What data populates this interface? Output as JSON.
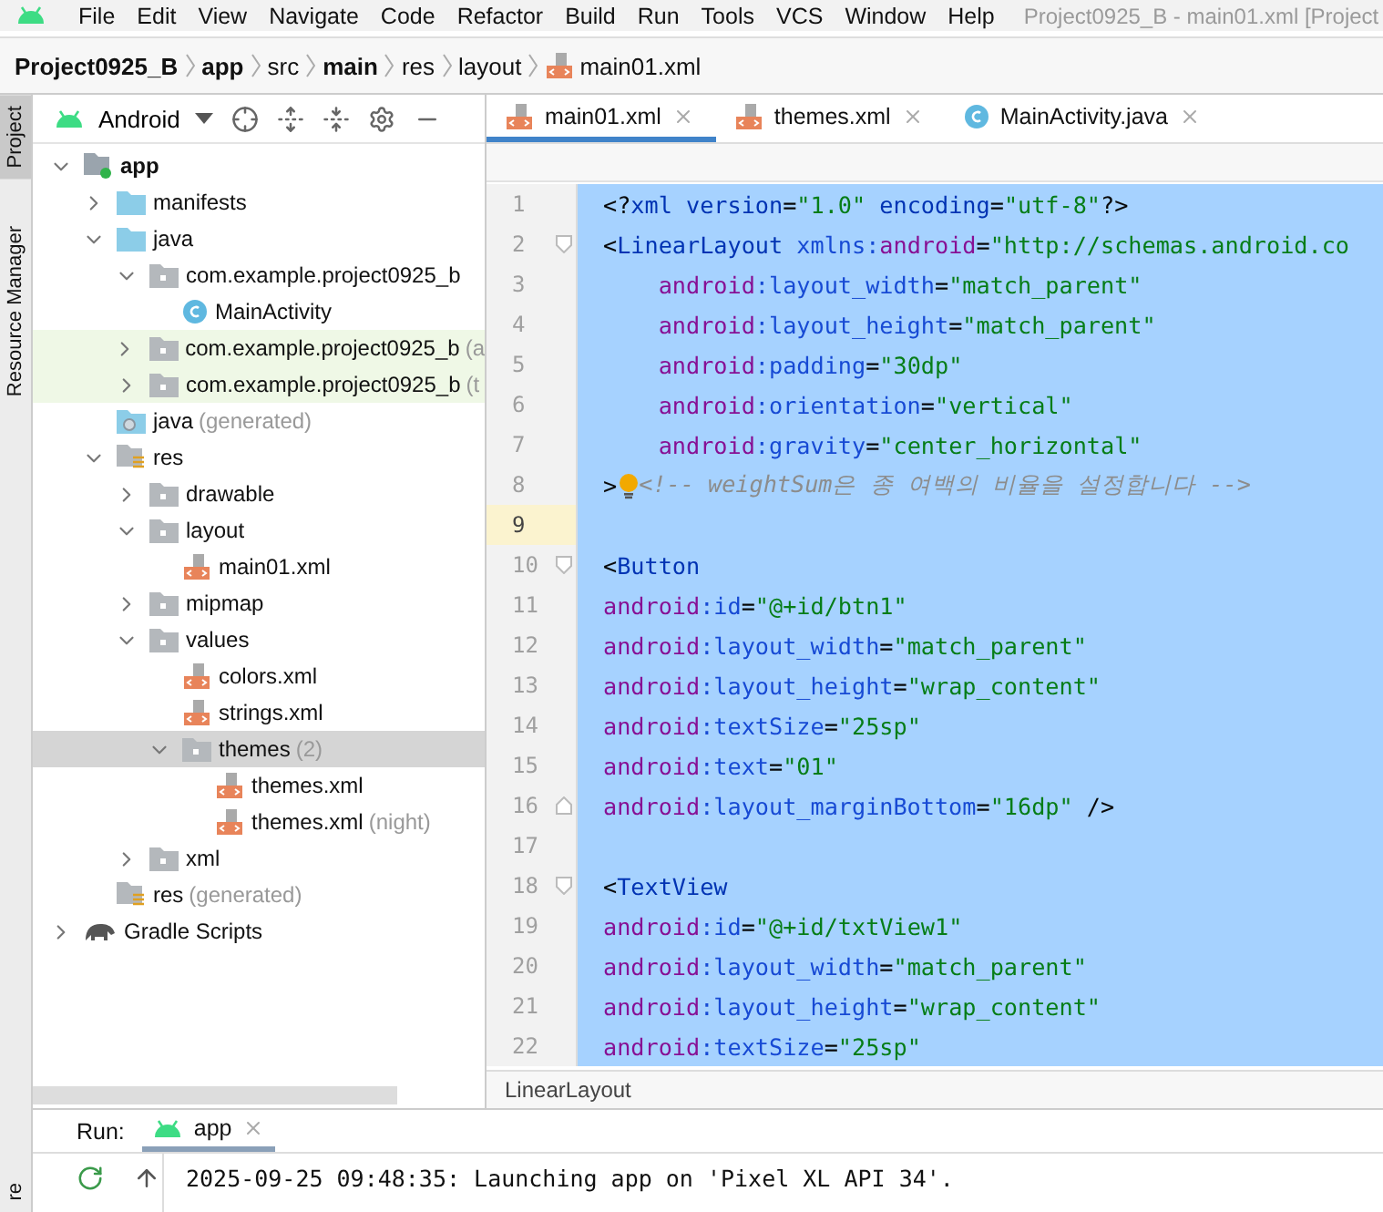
{
  "menu_bar": {
    "items": [
      "File",
      "Edit",
      "View",
      "Navigate",
      "Code",
      "Refactor",
      "Build",
      "Run",
      "Tools",
      "VCS",
      "Window",
      "Help"
    ],
    "title": "Project0925_B - main01.xml [Project"
  },
  "breadcrumb": [
    {
      "label": "Project0925_B",
      "bold": true,
      "kind": "text"
    },
    {
      "label": "app",
      "bold": true,
      "kind": "text"
    },
    {
      "label": "src",
      "bold": false,
      "kind": "text"
    },
    {
      "label": "main",
      "bold": true,
      "kind": "text"
    },
    {
      "label": "res",
      "bold": false,
      "kind": "text"
    },
    {
      "label": "layout",
      "bold": false,
      "kind": "text"
    },
    {
      "label": "main01.xml",
      "bold": false,
      "kind": "xml"
    }
  ],
  "side_strip": {
    "top": [
      "Project",
      "Resource Manager"
    ],
    "bottom": "re"
  },
  "project_panel": {
    "view": "Android",
    "tree": [
      {
        "label": "app",
        "kind": "module",
        "expanded": true,
        "selected": false,
        "highlight": false,
        "children": [
          {
            "label": "manifests",
            "kind": "bluefolder",
            "expanded": false,
            "selected": false,
            "highlight": false
          },
          {
            "label": "java",
            "kind": "bluefolder",
            "expanded": true,
            "selected": false,
            "highlight": false,
            "children": [
              {
                "label": "com.example.project0925_b",
                "kind": "package",
                "expanded": true,
                "selected": false,
                "highlight": false,
                "children": [
                  {
                    "label": "MainActivity",
                    "kind": "class",
                    "selected": false,
                    "highlight": false
                  }
                ]
              },
              {
                "label": "com.example.project0925_b",
                "hint": "(a",
                "kind": "package",
                "expanded": false,
                "selected": false,
                "highlight": true
              },
              {
                "label": "com.example.project0925_b",
                "hint": "(t",
                "kind": "package",
                "expanded": false,
                "selected": false,
                "highlight": true
              }
            ]
          },
          {
            "label": "java",
            "hint": "(generated)",
            "kind": "generated",
            "selected": false,
            "highlight": false
          },
          {
            "label": "res",
            "kind": "res",
            "expanded": true,
            "selected": false,
            "highlight": false,
            "children": [
              {
                "label": "drawable",
                "kind": "package",
                "expanded": false,
                "selected": false,
                "highlight": false
              },
              {
                "label": "layout",
                "kind": "package",
                "expanded": true,
                "selected": false,
                "highlight": false,
                "children": [
                  {
                    "label": "main01.xml",
                    "kind": "xml",
                    "selected": false,
                    "highlight": false
                  }
                ]
              },
              {
                "label": "mipmap",
                "kind": "package",
                "expanded": false,
                "selected": false,
                "highlight": false
              },
              {
                "label": "values",
                "kind": "package",
                "expanded": true,
                "selected": false,
                "highlight": false,
                "children": [
                  {
                    "label": "colors.xml",
                    "kind": "xml",
                    "selected": false,
                    "highlight": false
                  },
                  {
                    "label": "strings.xml",
                    "kind": "xml",
                    "selected": false,
                    "highlight": false
                  },
                  {
                    "label": "themes",
                    "hint": "(2)",
                    "kind": "package",
                    "expanded": true,
                    "selected": true,
                    "highlight": false,
                    "children": [
                      {
                        "label": "themes.xml",
                        "kind": "xml",
                        "selected": false,
                        "highlight": false
                      },
                      {
                        "label": "themes.xml",
                        "hint": "(night)",
                        "kind": "xml",
                        "selected": false,
                        "highlight": false
                      }
                    ]
                  }
                ]
              },
              {
                "label": "xml",
                "kind": "package",
                "expanded": false,
                "selected": false,
                "highlight": false
              }
            ]
          },
          {
            "label": "res",
            "hint": "(generated)",
            "kind": "res",
            "selected": false,
            "highlight": false
          }
        ]
      },
      {
        "label": "Gradle Scripts",
        "kind": "gradle",
        "expanded": false,
        "selected": false,
        "highlight": false
      }
    ]
  },
  "editor_tabs": [
    {
      "label": "main01.xml",
      "kind": "xml",
      "selected": true
    },
    {
      "label": "themes.xml",
      "kind": "xml",
      "selected": false
    },
    {
      "label": "MainActivity.java",
      "kind": "class",
      "selected": false
    }
  ],
  "code_lines": [
    {
      "number": "1",
      "selected": true,
      "current": false,
      "tokens": [
        {
          "kind": "punct",
          "text": "<?"
        },
        {
          "kind": "tag",
          "text": "xml version"
        },
        {
          "kind": "punct",
          "text": "="
        },
        {
          "kind": "value",
          "text": "\"1.0\""
        },
        {
          "kind": "tag",
          "text": " encoding"
        },
        {
          "kind": "punct",
          "text": "="
        },
        {
          "kind": "value",
          "text": "\"utf-8\""
        },
        {
          "kind": "punct",
          "text": "?>"
        }
      ]
    },
    {
      "number": "2",
      "selected": true,
      "current": false,
      "fold_start": true,
      "tokens": [
        {
          "kind": "punct",
          "text": "<"
        },
        {
          "kind": "tag",
          "text": "LinearLayout "
        },
        {
          "kind": "attr",
          "text": "xmlns:"
        },
        {
          "kind": "ns",
          "text": "android"
        },
        {
          "kind": "punct",
          "text": "="
        },
        {
          "kind": "value",
          "text": "\"http://schemas.android.co"
        }
      ]
    },
    {
      "number": "3",
      "selected": true,
      "current": false,
      "tokens": [
        {
          "kind": "ns",
          "text": "    android"
        },
        {
          "kind": "attr",
          "text": ":layout_width"
        },
        {
          "kind": "punct",
          "text": "="
        },
        {
          "kind": "value",
          "text": "\"match_parent\""
        }
      ]
    },
    {
      "number": "4",
      "selected": true,
      "current": false,
      "tokens": [
        {
          "kind": "ns",
          "text": "    android"
        },
        {
          "kind": "attr",
          "text": ":layout_height"
        },
        {
          "kind": "punct",
          "text": "="
        },
        {
          "kind": "value",
          "text": "\"match_parent\""
        }
      ]
    },
    {
      "number": "5",
      "selected": true,
      "current": false,
      "tokens": [
        {
          "kind": "ns",
          "text": "    android"
        },
        {
          "kind": "attr",
          "text": ":padding"
        },
        {
          "kind": "punct",
          "text": "="
        },
        {
          "kind": "value",
          "text": "\"30dp\""
        }
      ]
    },
    {
      "number": "6",
      "selected": true,
      "current": false,
      "tokens": [
        {
          "kind": "ns",
          "text": "    android"
        },
        {
          "kind": "attr",
          "text": ":orientation"
        },
        {
          "kind": "punct",
          "text": "="
        },
        {
          "kind": "value",
          "text": "\"vertical\""
        }
      ]
    },
    {
      "number": "7",
      "selected": true,
      "current": false,
      "tokens": [
        {
          "kind": "ns",
          "text": "    android"
        },
        {
          "kind": "attr",
          "text": ":gravity"
        },
        {
          "kind": "punct",
          "text": "="
        },
        {
          "kind": "value",
          "text": "\"center_horizontal\""
        }
      ]
    },
    {
      "number": "8",
      "selected": true,
      "current": false,
      "tokens": [
        {
          "kind": "punct",
          "text": ">"
        },
        {
          "kind": "bulb"
        },
        {
          "kind": "comment",
          "text": "<!-- weightSum은 종 여백의 비율을 설정합니다 -->"
        }
      ]
    },
    {
      "number": "9",
      "selected": true,
      "current": true
    },
    {
      "number": "10",
      "selected": true,
      "current": false,
      "fold_start": true,
      "tokens": [
        {
          "kind": "punct",
          "text": "<"
        },
        {
          "kind": "tag",
          "text": "Button"
        }
      ]
    },
    {
      "number": "11",
      "selected": true,
      "current": false,
      "tokens": [
        {
          "kind": "ns",
          "text": "android"
        },
        {
          "kind": "attr",
          "text": ":id"
        },
        {
          "kind": "punct",
          "text": "="
        },
        {
          "kind": "value",
          "text": "\"@+id/btn1\""
        }
      ]
    },
    {
      "number": "12",
      "selected": true,
      "current": false,
      "tokens": [
        {
          "kind": "ns",
          "text": "android"
        },
        {
          "kind": "attr",
          "text": ":layout_width"
        },
        {
          "kind": "punct",
          "text": "="
        },
        {
          "kind": "value",
          "text": "\"match_parent\""
        }
      ]
    },
    {
      "number": "13",
      "selected": true,
      "current": false,
      "tokens": [
        {
          "kind": "ns",
          "text": "android"
        },
        {
          "kind": "attr",
          "text": ":layout_height"
        },
        {
          "kind": "punct",
          "text": "="
        },
        {
          "kind": "value",
          "text": "\"wrap_content\""
        }
      ]
    },
    {
      "number": "14",
      "selected": true,
      "current": false,
      "tokens": [
        {
          "kind": "ns",
          "text": "android"
        },
        {
          "kind": "attr",
          "text": ":textSize"
        },
        {
          "kind": "punct",
          "text": "="
        },
        {
          "kind": "value",
          "text": "\"25sp\""
        }
      ]
    },
    {
      "number": "15",
      "selected": true,
      "current": false,
      "tokens": [
        {
          "kind": "ns",
          "text": "android"
        },
        {
          "kind": "attr",
          "text": ":text"
        },
        {
          "kind": "punct",
          "text": "="
        },
        {
          "kind": "value",
          "text": "\"01\""
        }
      ]
    },
    {
      "number": "16",
      "selected": true,
      "current": false,
      "fold_end": true,
      "tokens": [
        {
          "kind": "ns",
          "text": "android"
        },
        {
          "kind": "attr",
          "text": ":layout_marginBottom"
        },
        {
          "kind": "punct",
          "text": "="
        },
        {
          "kind": "value",
          "text": "\"16dp\""
        },
        {
          "kind": "punct",
          "text": " />"
        }
      ]
    },
    {
      "number": "17",
      "selected": true,
      "current": false
    },
    {
      "number": "18",
      "selected": true,
      "current": false,
      "fold_start": true,
      "tokens": [
        {
          "kind": "punct",
          "text": "<"
        },
        {
          "kind": "tag",
          "text": "TextView"
        }
      ]
    },
    {
      "number": "19",
      "selected": true,
      "current": false,
      "tokens": [
        {
          "kind": "ns",
          "text": "android"
        },
        {
          "kind": "attr",
          "text": ":id"
        },
        {
          "kind": "punct",
          "text": "="
        },
        {
          "kind": "value",
          "text": "\"@+id/txtView1\""
        }
      ]
    },
    {
      "number": "20",
      "selected": true,
      "current": false,
      "tokens": [
        {
          "kind": "ns",
          "text": "android"
        },
        {
          "kind": "attr",
          "text": ":layout_width"
        },
        {
          "kind": "punct",
          "text": "="
        },
        {
          "kind": "value",
          "text": "\"match_parent\""
        }
      ]
    },
    {
      "number": "21",
      "selected": true,
      "current": false,
      "tokens": [
        {
          "kind": "ns",
          "text": "android"
        },
        {
          "kind": "attr",
          "text": ":layout_height"
        },
        {
          "kind": "punct",
          "text": "="
        },
        {
          "kind": "value",
          "text": "\"wrap_content\""
        }
      ]
    },
    {
      "number": "22",
      "selected": true,
      "current": false,
      "tokens": [
        {
          "kind": "ns",
          "text": "android"
        },
        {
          "kind": "attr",
          "text": ":textSize"
        },
        {
          "kind": "punct",
          "text": "="
        },
        {
          "kind": "value",
          "text": "\"25sp\""
        }
      ]
    }
  ],
  "editor_footer": "LinearLayout",
  "run_panel": {
    "label": "Run:",
    "tabs": [
      {
        "label": "app",
        "selected": true
      }
    ],
    "console": [
      "2025-09-25 09:48:35: Launching app on 'Pixel XL API 34'."
    ]
  }
}
